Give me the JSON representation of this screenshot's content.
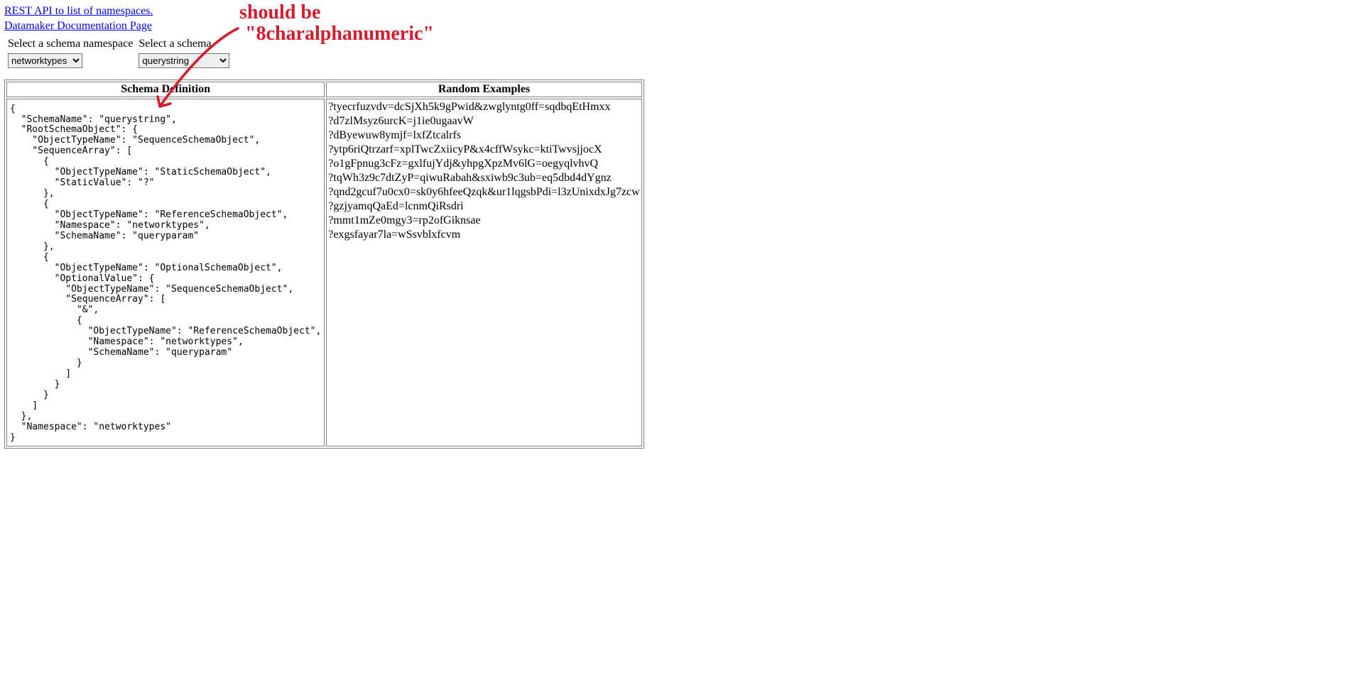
{
  "links": {
    "rest_api": "REST API to list of namespaces.",
    "docs": "Datamaker Documentation Page"
  },
  "selectors": {
    "namespace_label": "Select a schema namespace",
    "schema_label": "Select a schema",
    "namespace_value": "networktypes",
    "schema_value": "querystring"
  },
  "table": {
    "header_definition": "Schema Definition",
    "header_examples": "Random Examples",
    "schema_definition": "{\n  \"SchemaName\": \"querystring\",\n  \"RootSchemaObject\": {\n    \"ObjectTypeName\": \"SequenceSchemaObject\",\n    \"SequenceArray\": [\n      {\n        \"ObjectTypeName\": \"StaticSchemaObject\",\n        \"StaticValue\": \"?\"\n      },\n      {\n        \"ObjectTypeName\": \"ReferenceSchemaObject\",\n        \"Namespace\": \"networktypes\",\n        \"SchemaName\": \"queryparam\"\n      },\n      {\n        \"ObjectTypeName\": \"OptionalSchemaObject\",\n        \"OptionalValue\": {\n          \"ObjectTypeName\": \"SequenceSchemaObject\",\n          \"SequenceArray\": [\n            \"&\",\n            {\n              \"ObjectTypeName\": \"ReferenceSchemaObject\",\n              \"Namespace\": \"networktypes\",\n              \"SchemaName\": \"queryparam\"\n            }\n          ]\n        }\n      }\n    ]\n  },\n  \"Namespace\": \"networktypes\"\n}",
    "examples": [
      "?tyecrfuzvdv=dcSjXh5k9gPwid&zwglyntg0ff=sqdbqEtHmxx",
      "?d7zlMsyz6urcK=j1ie0ugaavW",
      "?dByewuw8ymjf=lxfZtcalrfs",
      "?ytp6riQtrzarf=xplTwcZxiicyP&x4cffWsykc=ktiTwvsjjocX",
      "?o1gFpnug3cFz=gxlfujYdj&yhpgXpzMv6lG=oegyqlvhvQ",
      "?tqWh3z9c7dtZyP=qiwuRabah&sxiwb9c3ub=eq5dbd4dYgnz",
      "?qnd2gcuf7u0cx0=sk0y6hfeeQzqk&ur1lqgsbPdi=l3zUnixdxJg7zcw",
      "?gzjyamqQaEd=lcnmQiRsdri",
      "?mmt1mZe0mgy3=rp2ofGiknsae",
      "?exgsfayar7la=wSsvblxfcvm"
    ]
  },
  "annotation": {
    "line1": "should be",
    "line2": "\"8charalphanumeric\""
  }
}
